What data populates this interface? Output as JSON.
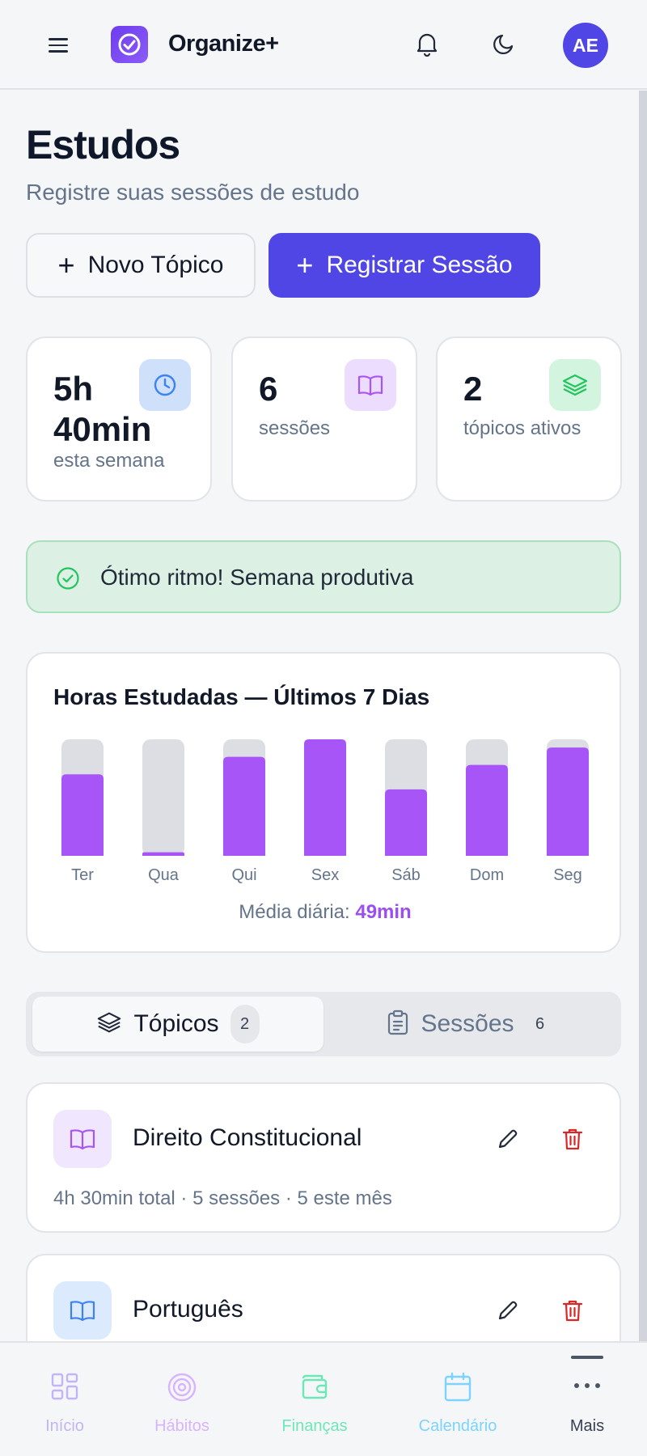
{
  "header": {
    "app_name": "Organize+",
    "avatar_initials": "AE",
    "colors": {
      "logo": "#7c3aed",
      "avatar": "#4f46e5"
    }
  },
  "page": {
    "title": "Estudos",
    "subtitle": "Registre suas sessões de estudo"
  },
  "actions": {
    "new_topic": "Novo Tópico",
    "register_session": "Registrar Sessão"
  },
  "stats": [
    {
      "value": "5h",
      "value2": "40min",
      "label": "esta semana",
      "icon": "clock-icon"
    },
    {
      "value": "6",
      "label": "sessões",
      "icon": "book-open-icon"
    },
    {
      "value": "2",
      "label": "tópicos ativos",
      "icon": "layers-icon"
    }
  ],
  "alert": {
    "text": "Ótimo ritmo! Semana produtiva",
    "icon": "check-circle-icon"
  },
  "chart_data": {
    "type": "bar",
    "title": "Horas Estudadas — Últimos 7 Dias",
    "categories": [
      "Ter",
      "Qua",
      "Qui",
      "Sex",
      "Sáb",
      "Dom",
      "Seg"
    ],
    "values": [
      0.7,
      0.03,
      0.85,
      1.0,
      0.57,
      0.78,
      0.93
    ],
    "ylim": [
      0,
      1
    ],
    "avg_label": "Média diária:",
    "avg_value": "49min",
    "colors": {
      "bar": "#a855f7",
      "track": "#dcdee3"
    }
  },
  "tabs": [
    {
      "label": "Tópicos",
      "count": "2",
      "icon": "layers-icon",
      "active": true
    },
    {
      "label": "Sessões",
      "count": "6",
      "icon": "clipboard-icon",
      "active": false
    }
  ],
  "topics": [
    {
      "name": "Direito Constitucional",
      "meta": "4h 30min total · 5 sessões · 5 este mês",
      "icon": "book-open-icon",
      "color": "#a855f7"
    },
    {
      "name": "Português",
      "meta": "",
      "icon": "book-open-icon",
      "color": "#3b82f6"
    }
  ],
  "nav": [
    {
      "label": "Início",
      "icon": "grid-icon",
      "color": "#c3b5f5"
    },
    {
      "label": "Hábitos",
      "icon": "target-icon",
      "color": "#d8b4fe"
    },
    {
      "label": "Finanças",
      "icon": "wallet-icon",
      "color": "#6ee7b7"
    },
    {
      "label": "Calendário",
      "icon": "calendar-icon",
      "color": "#7dd3fc"
    },
    {
      "label": "Mais",
      "icon": "more-icon",
      "color": "#4b5563"
    }
  ]
}
